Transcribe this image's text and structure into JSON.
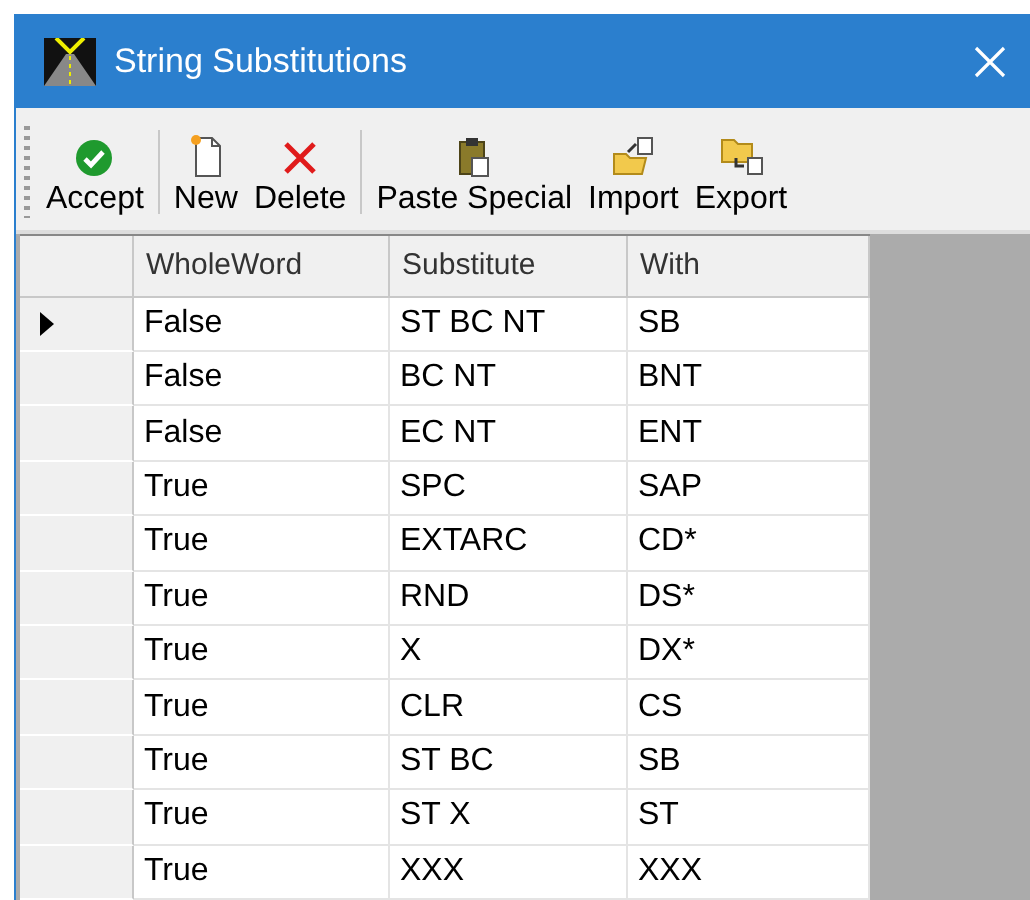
{
  "window": {
    "title": "String Substitutions"
  },
  "toolbar": {
    "groups": [
      [
        {
          "label": "Accept",
          "kind": "accept"
        }
      ],
      [
        {
          "label": "New",
          "kind": "new"
        },
        {
          "label": "Delete",
          "kind": "delete"
        }
      ],
      [
        {
          "label": "Paste Special",
          "kind": "paste"
        },
        {
          "label": "Import",
          "kind": "import"
        },
        {
          "label": "Export",
          "kind": "export"
        }
      ]
    ]
  },
  "table": {
    "columns": [
      "WholeWord",
      "Substitute",
      "With"
    ],
    "rows": [
      {
        "selected": true,
        "cells": [
          "False",
          "ST BC NT",
          "SB"
        ]
      },
      {
        "selected": false,
        "cells": [
          "False",
          "BC NT",
          "BNT"
        ]
      },
      {
        "selected": false,
        "cells": [
          "False",
          "EC NT",
          "ENT"
        ]
      },
      {
        "selected": false,
        "cells": [
          "True",
          "SPC",
          "SAP"
        ]
      },
      {
        "selected": false,
        "cells": [
          "True",
          "EXTARC",
          "CD*"
        ]
      },
      {
        "selected": false,
        "cells": [
          "True",
          "RND",
          "DS*"
        ]
      },
      {
        "selected": false,
        "cells": [
          "True",
          "X",
          "DX*"
        ]
      },
      {
        "selected": false,
        "cells": [
          "True",
          "CLR",
          "CS"
        ]
      },
      {
        "selected": false,
        "cells": [
          "True",
          "ST BC",
          "SB"
        ]
      },
      {
        "selected": false,
        "cells": [
          "True",
          "ST X",
          "ST"
        ]
      },
      {
        "selected": false,
        "cells": [
          "True",
          "XXX",
          "XXX"
        ]
      }
    ]
  }
}
